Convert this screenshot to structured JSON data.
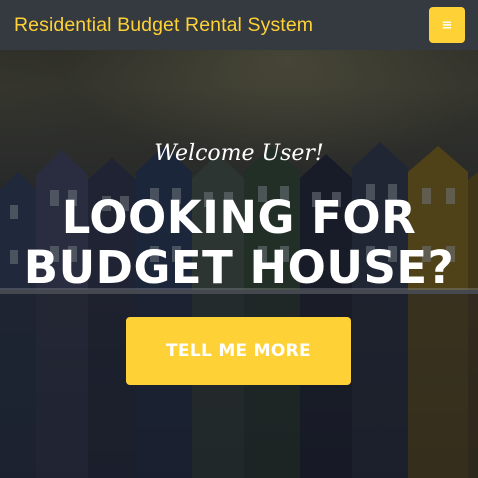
{
  "navbar": {
    "brand": "Residential Budget Rental System",
    "menu_icon": "hamburger-icon",
    "menu_glyph": "≡"
  },
  "masthead": {
    "lead_in": "Welcome User!",
    "heading_line1": "LOOKING FOR",
    "heading_line2": "BUDGET HOUSE?",
    "cta_label": "TELL ME MORE"
  },
  "colors": {
    "accent": "#fed136",
    "navbar_bg": "#343a40",
    "text": "#ffffff"
  }
}
